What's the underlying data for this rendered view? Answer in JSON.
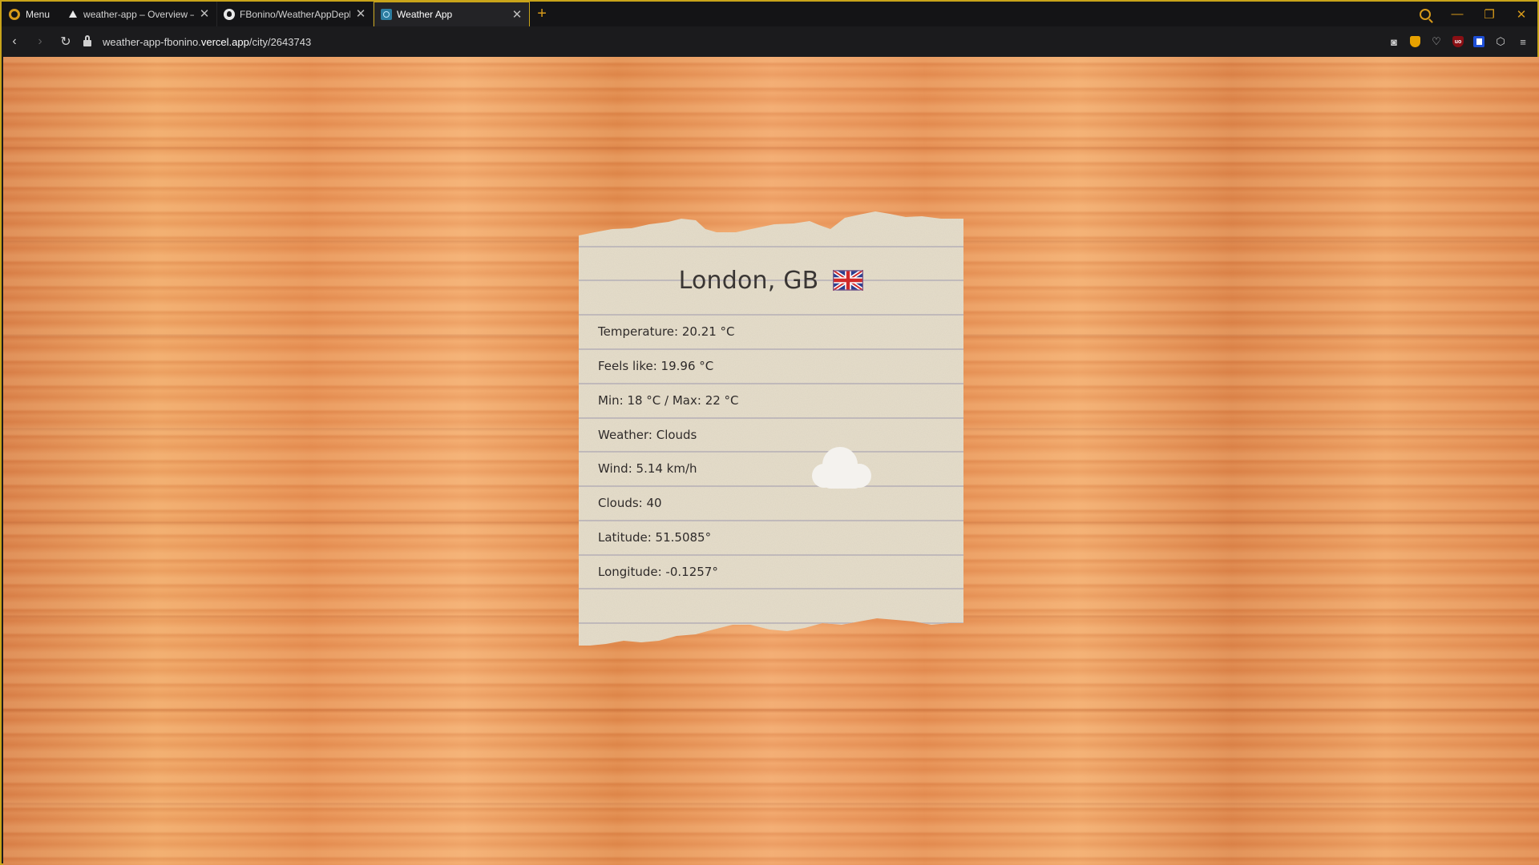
{
  "browser": {
    "menu_label": "Menu",
    "tabs": [
      {
        "title": "weather-app – Overview –",
        "favicon": "vercel-triangle-icon",
        "active": false
      },
      {
        "title": "FBonino/WeatherAppDeplo",
        "favicon": "github-icon",
        "active": false
      },
      {
        "title": "Weather App",
        "favicon": "react-app-icon",
        "active": true
      }
    ],
    "new_tab_symbol": "+",
    "url_prefix": "weather-app-fbonino.",
    "url_domain": "vercel.app",
    "url_path": "/city/2643743",
    "accent_color": "#d79a1a",
    "frame_color": "#c9a41a"
  },
  "weather": {
    "city": "London, GB",
    "country_flag": "united-kingdom-flag-icon",
    "details": [
      "Temperature: 20.21 °C",
      "Feels like: 19.96 °C",
      "Min: 18 °C / Max: 22 °C",
      "Weather: Clouds",
      "Wind: 5.14 km/h",
      "Clouds: 40",
      "Latitude: 51.5085°",
      "Longitude: -0.1257°"
    ],
    "condition_icon": "cloud-icon"
  },
  "colors": {
    "wood": "#e89a5c",
    "paper": "#e6decb",
    "paper_line": "#b8b2b8",
    "text": "#2f2b2a"
  }
}
